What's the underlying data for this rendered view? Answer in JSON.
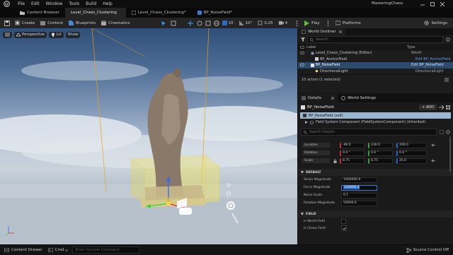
{
  "titlebar": {
    "menu": [
      "File",
      "Edit",
      "Window",
      "Tools",
      "Build",
      "Help"
    ],
    "project": "MasteringChaos"
  },
  "tabs": [
    {
      "label": "Content Browser"
    },
    {
      "label": "Level_Chaos_Clustering"
    },
    {
      "label": "Level_Chaos_Clustering*"
    },
    {
      "label": "BP_NoiseField*"
    }
  ],
  "toolbar": {
    "create": "Create",
    "content": "Content",
    "blueprints": "Blueprints",
    "cinematics": "Cinematics",
    "play": "Play",
    "platforms": "Platforms",
    "settings": "Settings",
    "grid_snap": "10",
    "rot_snap": "10°",
    "scale_snap": "0.25",
    "cam_speed": "4"
  },
  "viewport": {
    "perspective": "Perspective",
    "lit": "Lit",
    "show": "Show"
  },
  "outliner": {
    "tab": "World Outliner",
    "search_placeholder": "Search...",
    "col_label": "Label",
    "col_type": "Type",
    "rows": [
      {
        "label": "Level_Chaos_Clustering (Editor)",
        "type": "World"
      },
      {
        "label": "BP_AnchorField",
        "type": "Edit BP_AnchorField"
      },
      {
        "label": "BP_NoiseField",
        "type": "Edit BP_NoiseField"
      },
      {
        "label": "DirectionalLight",
        "type": "DirectionalLight"
      }
    ],
    "footer": "10 actors (1 selected)"
  },
  "details": {
    "tab": "Details",
    "tab2": "World Settings",
    "actor_name": "BP_NoiseField",
    "add_label": "+ ADD",
    "self_row": "BP_NoiseField (self)",
    "component_row": "Field System Component (FieldSystemComponent) (Inherited)",
    "search_placeholder": "Search Details",
    "transform": {
      "location_label": "Location",
      "location": [
        "-90.0",
        "230.0",
        "200.0"
      ],
      "rotation_label": "Rotation",
      "rotation": [
        "0.0 °",
        "0.0 °",
        "0.0 °"
      ],
      "scale_label": "Scale",
      "scale": [
        "8.75",
        "8.75",
        "25.0"
      ]
    },
    "section_default": "DEFAULT",
    "props": [
      {
        "label": "Strain Magnitude",
        "value": "1000000.0"
      },
      {
        "label": "Force Magnitude",
        "value": "100000.0"
      },
      {
        "label": "Noise Scale",
        "value": "0.1"
      },
      {
        "label": "Rotation Magnitude",
        "value": "50000.0"
      }
    ],
    "section_field": "FIELD",
    "field_props": [
      {
        "label": "Is World Field"
      },
      {
        "label": "Is Chaos Field"
      }
    ]
  },
  "statusbar": {
    "content_drawer": "Content Drawer",
    "cmd": "Cmd",
    "console_placeholder": "Enter Console Command",
    "source_control": "Source Control Off"
  },
  "colors": {
    "accent_blue": "#2a6cc4",
    "play_green": "#5bbd3a",
    "selection_row": "#2c4a6e",
    "field_yellow": "#f0e050"
  }
}
